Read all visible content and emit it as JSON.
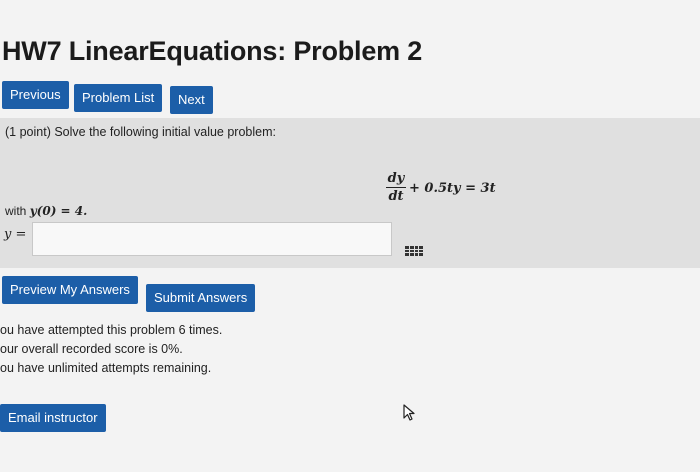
{
  "header": {
    "title": "HW7 LinearEquations: Problem 2"
  },
  "nav": {
    "previous": "Previous",
    "problem_list": "Problem List",
    "next": "Next"
  },
  "problem": {
    "points": "(1 point) Solve the following initial value problem:",
    "eq_num": "dy",
    "eq_den": "dt",
    "eq_rest": "+ 0.5ty = 3t",
    "with_prefix": "with",
    "initial_condition": "y(0) = 4.",
    "answer_label": "y =",
    "answer_value": ""
  },
  "actions": {
    "preview": "Preview My Answers",
    "submit": "Submit Answers"
  },
  "status": {
    "attempts": "ou have attempted this problem 6 times.",
    "score": "our overall recorded score is 0%.",
    "unlimited": "ou have unlimited attempts remaining."
  },
  "footer": {
    "email": "Email instructor"
  },
  "icons": {
    "equation_editor": "grid-icon",
    "cursor": "mouse-pointer-icon"
  },
  "colors": {
    "button_blue": "#1c5ea8",
    "problem_bg": "#e0e0e0"
  }
}
